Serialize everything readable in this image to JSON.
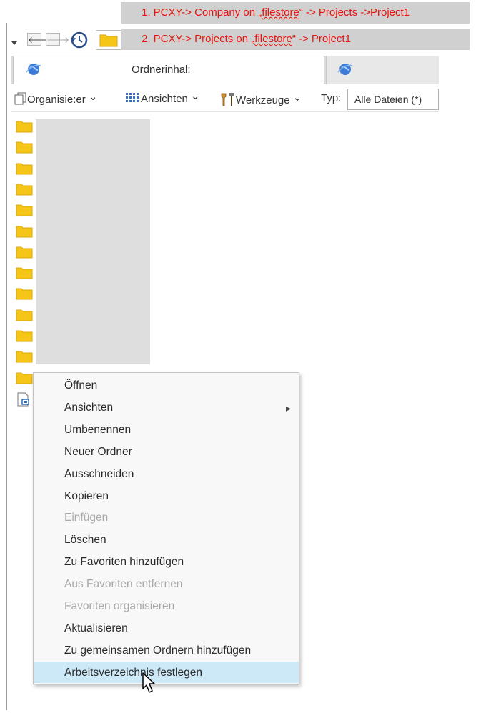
{
  "annotations": [
    {
      "prefix": "1. PCXY-> Company on „",
      "link": "filestore",
      "suffix": "“  -> Projects ->Project1"
    },
    {
      "prefix": "2. PCXY-> Projects on „",
      "link": "filestore",
      "suffix": "“  -> Project1"
    }
  ],
  "nav": {
    "back": "🡐",
    "forward": "🡒"
  },
  "tabs": {
    "active_label": "Ordnerinhal:"
  },
  "commandbar": {
    "organize_label": "Organisie:er",
    "views_label": "Ansichten",
    "tools_label": "Werkzeuge",
    "type_label": "Typ:",
    "type_value": "Alle Dateien (*)",
    "chevron": "⌄"
  },
  "context_menu": {
    "submenu_arrow": "▸",
    "items": [
      {
        "label": "Öffnen",
        "enabled": true
      },
      {
        "label": "Ansichten",
        "enabled": true,
        "submenu": true
      },
      {
        "label": "Umbenennen",
        "enabled": true
      },
      {
        "label": "Neuer Ordner",
        "enabled": true
      },
      {
        "label": "Ausschneiden",
        "enabled": true
      },
      {
        "label": "Kopieren",
        "enabled": true
      },
      {
        "label": "Einfügen",
        "enabled": false
      },
      {
        "label": "Löschen",
        "enabled": true
      },
      {
        "label": "Zu Favoriten hinzufügen",
        "enabled": true
      },
      {
        "label": "Aus Favoriten entfernen",
        "enabled": false
      },
      {
        "label": "Favoriten organisieren",
        "enabled": false
      },
      {
        "label": "Aktualisieren",
        "enabled": true
      },
      {
        "label": "Zu gemeinsamen Ordnern hinzufügen",
        "enabled": true
      },
      {
        "label": "Arbeitsverzeichnis festlegen",
        "enabled": true,
        "highlighted": true
      }
    ]
  },
  "colors": {
    "annotation_text": "#e8140c",
    "highlight": "#cde8f7",
    "folder": "#f5c518"
  }
}
